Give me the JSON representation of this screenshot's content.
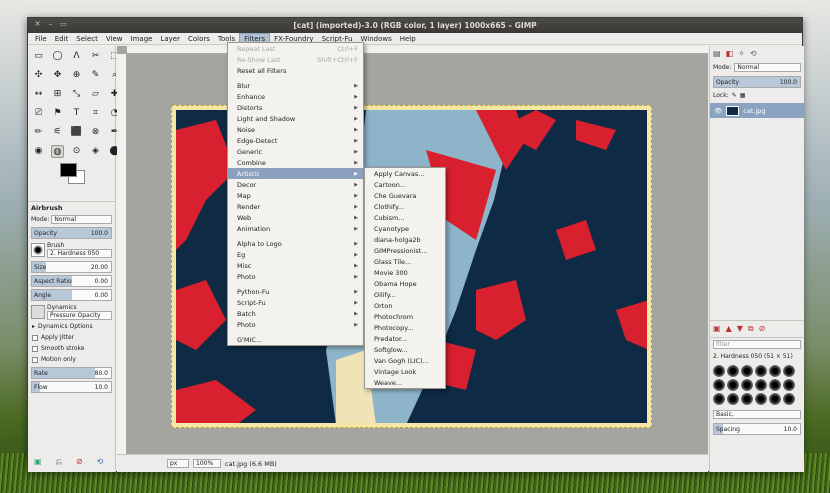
{
  "window": {
    "title": "[cat] (imported)-3.0 (RGB color, 1 layer) 1000x665 – GIMP",
    "controls": [
      "✕",
      "–",
      "▭"
    ]
  },
  "menubar": [
    "File",
    "Edit",
    "Select",
    "View",
    "Image",
    "Layer",
    "Colors",
    "Tools",
    "Filters",
    "FX-Foundry",
    "Script-Fu",
    "Windows",
    "Help"
  ],
  "toolbox": {
    "tools": [
      "▭",
      "◯",
      "ⴷ",
      "✂",
      "⬚",
      "✣",
      "✥",
      "⊕",
      "✎",
      "⌕",
      "↔",
      "⊞",
      "⤡",
      "▱",
      "✚",
      "⎚",
      "⚑",
      "T",
      "⌗",
      "◔",
      "✏",
      "⚟",
      "⬛",
      "⊗",
      "✒",
      "◉",
      "◍",
      "⊙",
      "◈",
      "⬤"
    ],
    "tool_options_title": "Airbrush",
    "mode_label": "Mode:",
    "mode_value": "Normal",
    "opacity_label": "Opacity",
    "opacity_value": "100.0",
    "brush_label": "Brush",
    "brush_value": "2. Hardness 050",
    "size_label": "Size",
    "size_value": "20.00",
    "aspect_label": "Aspect Ratio",
    "aspect_value": "0.00",
    "angle_label": "Angle",
    "angle_value": "0.00",
    "dynamics_label": "Dynamics",
    "dynamics_value": "Pressure Opacity",
    "dynamics_options": "Dynamics Options",
    "apply_jitter": "Apply Jitter",
    "smooth_stroke": "Smooth stroke",
    "motion_only": "Motion only",
    "rate_label": "Rate",
    "rate_value": "80.0",
    "flow_label": "Flow",
    "flow_value": "10.0"
  },
  "statusbar": {
    "unit": "px",
    "zoom": "100%",
    "file": "cat.jpg (6.6 MB)"
  },
  "dock": {
    "mode_label": "Mode:",
    "mode_value": "Normal",
    "opacity_label": "Opacity",
    "opacity_value": "100.0",
    "lock_label": "Lock:",
    "layer_name": "cat.jpg",
    "filter_placeholder": "filter",
    "brush_name": "2. Hardness 050 (51 × 51)",
    "preset_value": "Basic,",
    "spacing_label": "Spacing",
    "spacing_value": "10.0"
  },
  "filters_menu": [
    {
      "label": "Repeat Last",
      "shortcut": "Ctrl+F",
      "disabled": true
    },
    {
      "label": "Re-Show Last",
      "shortcut": "Shift+Ctrl+F",
      "disabled": true
    },
    {
      "label": "Reset all Filters",
      "shortcut": ""
    },
    {
      "sep": true
    },
    {
      "label": "Blur",
      "sub": true
    },
    {
      "label": "Enhance",
      "sub": true
    },
    {
      "label": "Distorts",
      "sub": true
    },
    {
      "label": "Light and Shadow",
      "sub": true
    },
    {
      "label": "Noise",
      "sub": true
    },
    {
      "label": "Edge-Detect",
      "sub": true
    },
    {
      "label": "Generic",
      "sub": true
    },
    {
      "label": "Combine",
      "sub": true
    },
    {
      "label": "Artistic",
      "sub": true,
      "active": true
    },
    {
      "label": "Decor",
      "sub": true
    },
    {
      "label": "Map",
      "sub": true
    },
    {
      "label": "Render",
      "sub": true
    },
    {
      "label": "Web",
      "sub": true
    },
    {
      "label": "Animation",
      "sub": true
    },
    {
      "sep": true
    },
    {
      "label": "Alpha to Logo",
      "sub": true
    },
    {
      "label": "Eg",
      "sub": true
    },
    {
      "label": "Misc",
      "sub": true
    },
    {
      "label": "Photo",
      "sub": true
    },
    {
      "sep": true
    },
    {
      "label": "Python-Fu",
      "sub": true
    },
    {
      "label": "Script-Fu",
      "sub": true
    },
    {
      "label": "Batch",
      "sub": true
    },
    {
      "label": "Photo",
      "sub": true
    },
    {
      "sep": true
    },
    {
      "label": "G'MIC...",
      "shortcut": ""
    }
  ],
  "artistic_menu": [
    "Apply Canvas...",
    "Cartoon...",
    "Che Guevara",
    "Clothify...",
    "Cubism...",
    "Cyanotype",
    "diana-holga2b",
    "GIMPressionist...",
    "Glass Tile...",
    "Movie 300",
    "Obama Hope",
    "Oilify...",
    "Orton",
    "Photochrom",
    "Photocopy...",
    "Predator...",
    "Softglow...",
    "Van Gogh (LIC)...",
    "Vintage Look",
    "Weave..."
  ],
  "colors": {
    "image_bg": "#0f2a44",
    "poster_red": "#d8202e",
    "poster_blue": "#8db4c8",
    "poster_cream": "#f0e3b8",
    "menu_highlight": "#8aa0be"
  }
}
